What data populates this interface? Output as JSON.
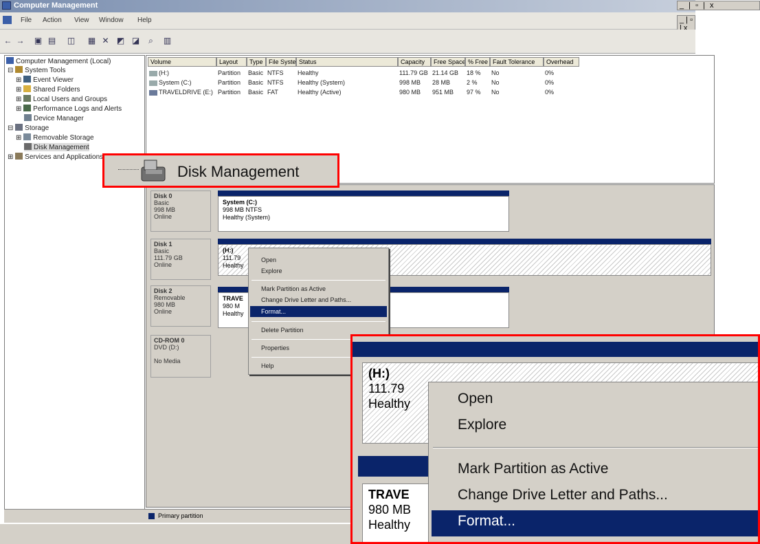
{
  "window": {
    "title": "Computer Management",
    "controls": "_ | ▫ | x",
    "inner_controls": "_ | ▫ | x"
  },
  "menubar": [
    "File",
    "Action",
    "View",
    "Window",
    "Help"
  ],
  "tree": {
    "root": "Computer Management (Local)",
    "items": [
      "System Tools",
      "Event Viewer",
      "Shared Folders",
      "Local Users and Groups",
      "Performance Logs and Alerts",
      "Device Manager",
      "Storage",
      "Removable Storage",
      "Disk Management",
      "Services and Applications"
    ]
  },
  "volume_table": {
    "columns": [
      "Volume",
      "Layout",
      "Type",
      "File System",
      "Status",
      "Capacity",
      "Free Space",
      "% Free",
      "Fault Tolerance",
      "Overhead"
    ],
    "rows": [
      [
        "(H:)",
        "Partition",
        "Basic",
        "NTFS",
        "Healthy",
        "111.79 GB",
        "21.14 GB",
        "18 %",
        "No",
        "0%"
      ],
      [
        "System (C:)",
        "Partition",
        "Basic",
        "NTFS",
        "Healthy (System)",
        "998 MB",
        "28 MB",
        "2 %",
        "No",
        "0%"
      ],
      [
        "TRAVELDRIVE (E:)",
        "Partition",
        "Basic",
        "FAT",
        "Healthy (Active)",
        "980 MB",
        "951 MB",
        "97 %",
        "No",
        "0%"
      ]
    ]
  },
  "disks": [
    {
      "name": "Disk 0",
      "lines": [
        "Basic",
        "998 MB",
        "Online"
      ],
      "part_title": "System (C:)",
      "part_lines": [
        "998 MB NTFS",
        "Healthy (System)"
      ]
    },
    {
      "name": "Disk 1",
      "lines": [
        "Basic",
        "111.79 GB",
        "Online"
      ],
      "part_title": "(H:)",
      "part_lines": [
        "111.79",
        "Healthy"
      ]
    },
    {
      "name": "Disk 2",
      "lines": [
        "Removable",
        "980 MB",
        "Online"
      ],
      "part_title": "TRAVE",
      "part_lines": [
        "980 M",
        "Healthy"
      ]
    },
    {
      "name": "CD-ROM 0",
      "lines": [
        "DVD (D:)",
        "",
        "No Media"
      ]
    }
  ],
  "context_menu": {
    "items": [
      "Open",
      "Explore",
      "Mark Partition as Active",
      "Change Drive Letter and Paths...",
      "Format...",
      "Delete Partition",
      "Properties",
      "Help"
    ],
    "selected": "Format..."
  },
  "status": {
    "legend": "Primary partition"
  },
  "callout_disk_mgmt": {
    "label": "Disk Management"
  },
  "zoom": {
    "part1_title": "(H:)",
    "part1_l1": "111.79",
    "part1_l2": "Healthy",
    "part2_title": "TRAVE",
    "part2_l1": "980 MB",
    "part2_l2": "Healthy",
    "menu": [
      "Open",
      "Explore",
      "Mark Partition as Active",
      "Change Drive Letter and Paths...",
      "Format..."
    ]
  },
  "colors": {
    "selection": "#0a246a",
    "callout_border": "#ff0000",
    "disk_bar": "#0a246a"
  }
}
